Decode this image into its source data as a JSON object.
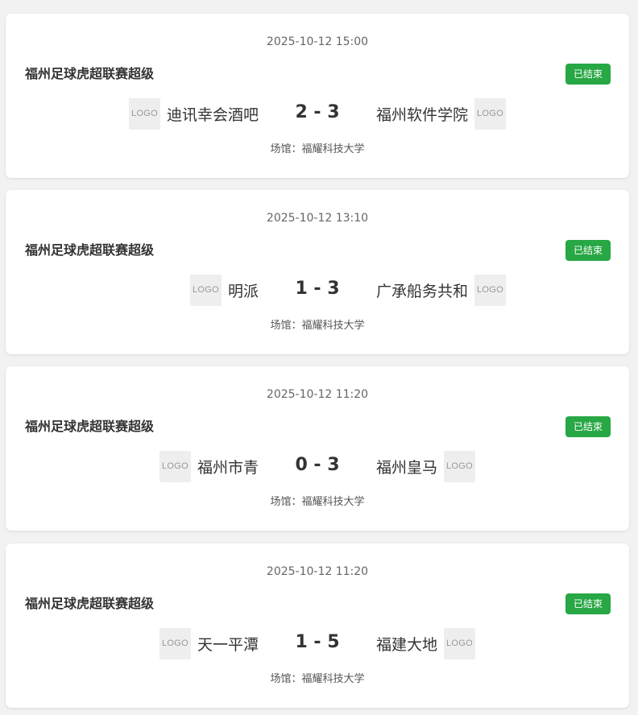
{
  "venue_prefix": "场馆：",
  "logo_text": "LOGO",
  "status_color": "#28a745",
  "matches": [
    {
      "datetime": "2025-10-12 15:00",
      "league": "福州足球虎超联赛超级",
      "status": "已结束",
      "home_team": "迪讯幸会酒吧",
      "score": "2 - 3",
      "away_team": "福州软件学院",
      "venue": "场馆：福耀科技大学"
    },
    {
      "datetime": "2025-10-12 13:10",
      "league": "福州足球虎超联赛超级",
      "status": "已结束",
      "home_team": "明派",
      "score": "1 - 3",
      "away_team": "广承船务共和",
      "venue": "场馆：福耀科技大学"
    },
    {
      "datetime": "2025-10-12 11:20",
      "league": "福州足球虎超联赛超级",
      "status": "已结束",
      "home_team": "福州市青",
      "score": "0 - 3",
      "away_team": "福州皇马",
      "venue": "场馆：福耀科技大学"
    },
    {
      "datetime": "2025-10-12 11:20",
      "league": "福州足球虎超联赛超级",
      "status": "已结束",
      "home_team": "天一平潭",
      "score": "1 - 5",
      "away_team": "福建大地",
      "venue": "场馆：福耀科技大学"
    }
  ]
}
